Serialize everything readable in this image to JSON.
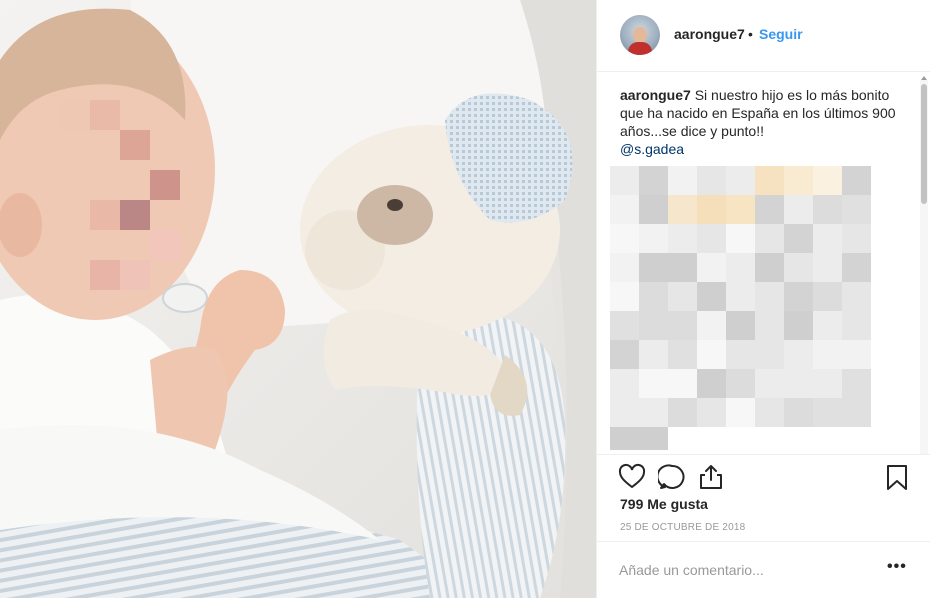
{
  "header": {
    "username": "aarongue7",
    "separator": "•",
    "follow_label": "Seguir"
  },
  "caption": {
    "username": "aarongue7",
    "text": "Si nuestro hijo es lo más bonito que ha nacido en España en los últimos 900 años...se dice y punto!!",
    "mention": "@s.gadea"
  },
  "actions": {
    "icons": [
      "heart-icon",
      "comment-icon",
      "share-icon",
      "bookmark-icon"
    ]
  },
  "likes": {
    "label": "799 Me gusta"
  },
  "date": {
    "label": "25 DE OCTUBRE DE 2018"
  },
  "comment": {
    "placeholder": "Añade un comentario...",
    "more_label": "•••"
  },
  "colors": {
    "link": "#3897f0",
    "mention": "#003569",
    "text": "#262626",
    "muted": "#999999",
    "border": "#efefef"
  }
}
